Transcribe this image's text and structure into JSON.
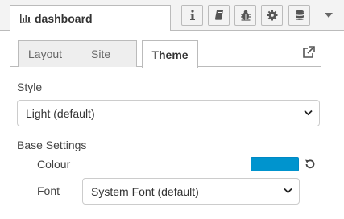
{
  "header": {
    "tab_title": "dashboard",
    "tab_icon": "bar-chart-icon",
    "buttons": [
      {
        "name": "info-button",
        "icon": "info-icon"
      },
      {
        "name": "help-button",
        "icon": "book-icon"
      },
      {
        "name": "debug-button",
        "icon": "bug-icon"
      },
      {
        "name": "config-button",
        "icon": "gear-icon"
      },
      {
        "name": "context-button",
        "icon": "database-icon"
      }
    ],
    "menu_icon": "chevron-down-icon"
  },
  "tabs": [
    {
      "label": "Layout",
      "active": false
    },
    {
      "label": "Site",
      "active": false
    },
    {
      "label": "Theme",
      "active": true
    }
  ],
  "theme": {
    "style_label": "Style",
    "style_value": "Light (default)",
    "base_settings_label": "Base Settings",
    "colour_label": "Colour",
    "colour_value": "#0094ce",
    "font_label": "Font",
    "font_value": "System Font (default)"
  },
  "colors": {
    "accent": "#0094ce",
    "border": "#bbbbbb",
    "header_bg": "#f3f3f3"
  }
}
